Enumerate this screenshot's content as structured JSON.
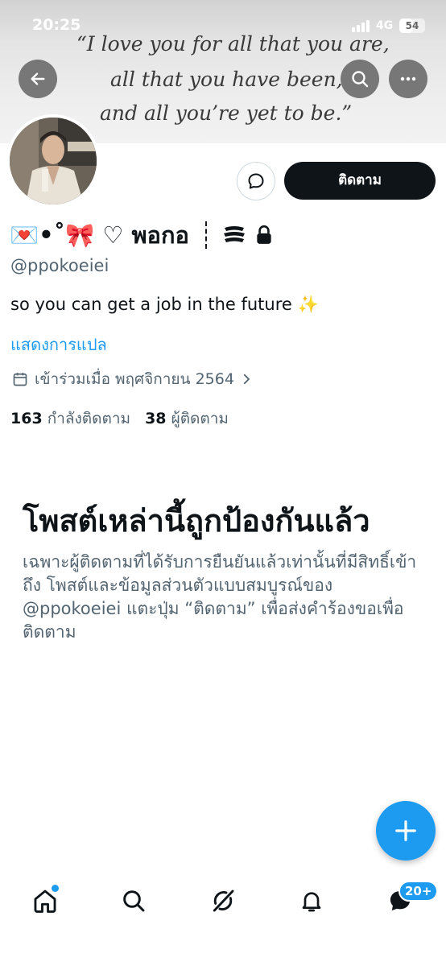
{
  "status_bar": {
    "time": "20:25",
    "network": "4G",
    "battery": "54",
    "battery_level": 0.54
  },
  "banner": {
    "quote_lines": [
      "“I love you for all that you are,",
      "all that you have been,",
      "and all you’re yet to be.”"
    ]
  },
  "header": {
    "back_icon": "arrow-left-icon",
    "search_icon": "search-icon",
    "more_icon": "more-horizontal-icon"
  },
  "profile": {
    "display_name": "💌•˚🎀 ♡ พอกอ",
    "handle": "@ppokoeiei",
    "bio": "so you can get a job in the future ✨",
    "translate_label": "แสดงการแปล",
    "joined": "เข้าร่วมเมื่อ พฤศจิกายน 2564",
    "following_count": "163",
    "following_label": "กำลังติดตาม",
    "followers_count": "38",
    "followers_label": "ผู้ติดตาม"
  },
  "actions": {
    "follow_label": "ติดตาม",
    "message_icon": "message-bubble-icon"
  },
  "protected": {
    "title": "โพสต์เหล่านี้ถูกป้องกันแล้ว",
    "description": "เฉพาะผู้ติดตามที่ได้รับการยืนยันแล้วเท่านั้นที่มีสิทธิ์เข้าถึง โพสต์และข้อมูลส่วนตัวแบบสมบูรณ์ของ @ppokoeiei แตะปุ่ม “ติดตาม” เพื่อส่งคำร้องขอเพื่อติดตาม"
  },
  "fab": {
    "icon": "plus-icon"
  },
  "bottom_nav": {
    "items": [
      "home-icon",
      "search-icon",
      "grok-icon",
      "bell-icon",
      "messages-icon"
    ],
    "messages_badge": "20+"
  },
  "colors": {
    "accent": "#1d9bf0",
    "text": "#0f1419",
    "secondary": "#536471"
  }
}
